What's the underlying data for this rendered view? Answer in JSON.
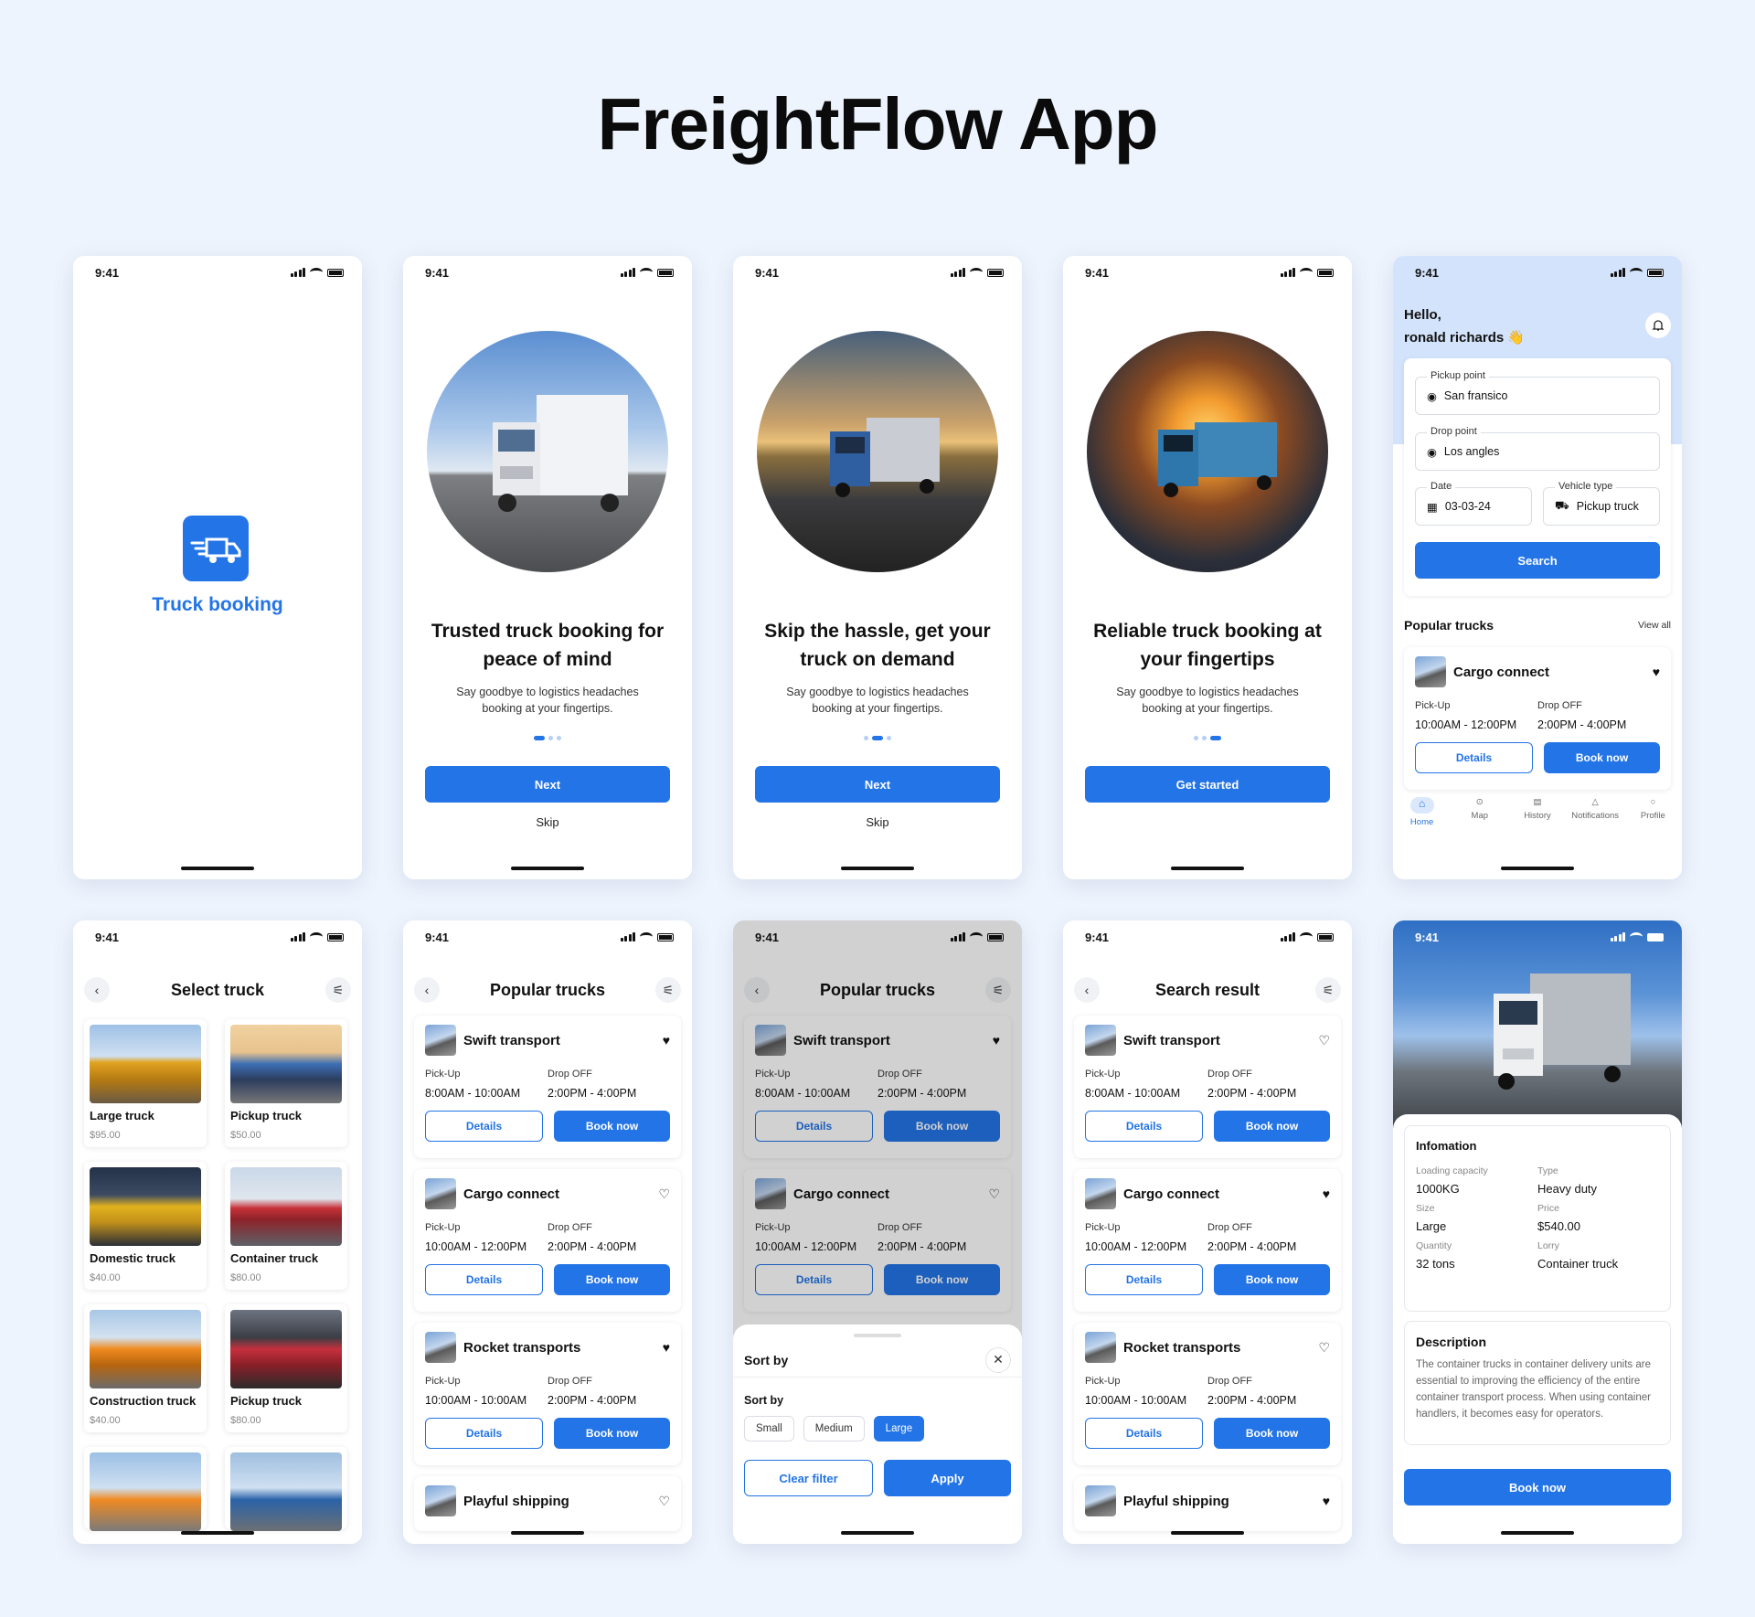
{
  "title": "FreightFlow App",
  "status_time": "9:41",
  "splash": {
    "brand": "Truck booking"
  },
  "onboarding": [
    {
      "heading": "Trusted truck booking for peace of mind",
      "body": "Say goodbye to logistics headaches booking at your fingertips.",
      "button": "Next",
      "skip": "Skip",
      "active_dot": 0
    },
    {
      "heading": "Skip the hassle, get your truck on demand",
      "body": "Say goodbye to logistics headaches booking at your fingertips.",
      "button": "Next",
      "skip": "Skip",
      "active_dot": 1
    },
    {
      "heading": "Reliable truck booking at your fingertips",
      "body": "Say goodbye to logistics headaches booking at your fingertips.",
      "button": "Get started",
      "skip": "",
      "active_dot": 2
    }
  ],
  "dashboard": {
    "greeting": "Hello,",
    "user": "ronald richards 👋",
    "pickup_label": "Pickup point",
    "pickup_value": "San fransico",
    "drop_label": "Drop point",
    "drop_value": "Los angles",
    "date_label": "Date",
    "date_value": "03-03-24",
    "vehicle_label": "Vehicle type",
    "vehicle_value": "Pickup truck",
    "search_button": "Search",
    "popular_title": "Popular trucks",
    "view_all": "View all",
    "card": {
      "name": "Cargo connect",
      "pickup_label": "Pick-Up",
      "drop_label": "Drop OFF",
      "pickup_time": "10:00AM - 12:00PM",
      "drop_time": "2:00PM - 4:00PM",
      "details": "Details",
      "book": "Book now",
      "liked": true
    },
    "nav": [
      "Home",
      "Map",
      "History",
      "Notifications",
      "Profile"
    ]
  },
  "select_truck": {
    "title": "Select truck",
    "items": [
      {
        "name": "Large truck",
        "price": "$95.00"
      },
      {
        "name": "Pickup truck",
        "price": "$50.00"
      },
      {
        "name": "Domestic truck",
        "price": "$40.00"
      },
      {
        "name": "Container truck",
        "price": "$80.00"
      },
      {
        "name": "Construction truck",
        "price": "$40.00"
      },
      {
        "name": "Pickup truck",
        "price": "$80.00"
      }
    ]
  },
  "labels": {
    "pickup": "Pick-Up",
    "drop": "Drop OFF",
    "details": "Details",
    "book": "Book now"
  },
  "popular": {
    "title": "Popular trucks",
    "cards": [
      {
        "name": "Swift transport",
        "pickup": "8:00AM - 10:00AM",
        "drop": "2:00PM - 4:00PM",
        "liked": true
      },
      {
        "name": "Cargo connect",
        "pickup": "10:00AM - 12:00PM",
        "drop": "2:00PM - 4:00PM",
        "liked": false
      },
      {
        "name": "Rocket transports",
        "pickup": "10:00AM - 10:00AM",
        "drop": "2:00PM - 4:00PM",
        "liked": true
      },
      {
        "name": "Playful shipping",
        "liked": false
      }
    ]
  },
  "sort_sheet": {
    "title": "Sort by",
    "section": "Sort by",
    "options": [
      "Small",
      "Medium",
      "Large"
    ],
    "selected": "Large",
    "clear": "Clear filter",
    "apply": "Apply"
  },
  "search_result": {
    "title": "Search result",
    "cards": [
      {
        "name": "Swift transport",
        "pickup": "8:00AM - 10:00AM",
        "drop": "2:00PM - 4:00PM",
        "liked": false
      },
      {
        "name": "Cargo connect",
        "pickup": "10:00AM - 12:00PM",
        "drop": "2:00PM - 4:00PM",
        "liked": true
      },
      {
        "name": "Rocket transports",
        "pickup": "10:00AM - 10:00AM",
        "drop": "2:00PM - 4:00PM",
        "liked": false
      },
      {
        "name": "Playful shipping",
        "liked": true
      }
    ]
  },
  "detail": {
    "info_title": "Infomation",
    "specs": [
      {
        "label": "Loading capacity",
        "value": "1000KG"
      },
      {
        "label": "Type",
        "value": "Heavy duty"
      },
      {
        "label": "Size",
        "value": "Large"
      },
      {
        "label": "Price",
        "value": "$540.00"
      },
      {
        "label": "Quantity",
        "value": "32 tons"
      },
      {
        "label": "Lorry",
        "value": "Container truck"
      }
    ],
    "desc_title": "Description",
    "desc": "The container trucks in container delivery units are essential to improving the efficiency of the entire container transport process. When using container handlers, it becomes easy for operators.",
    "book": "Book now"
  },
  "colors": {
    "accent": "#2374e6",
    "bg": "#eef4fd",
    "dash_top": "#d3e3fb"
  }
}
